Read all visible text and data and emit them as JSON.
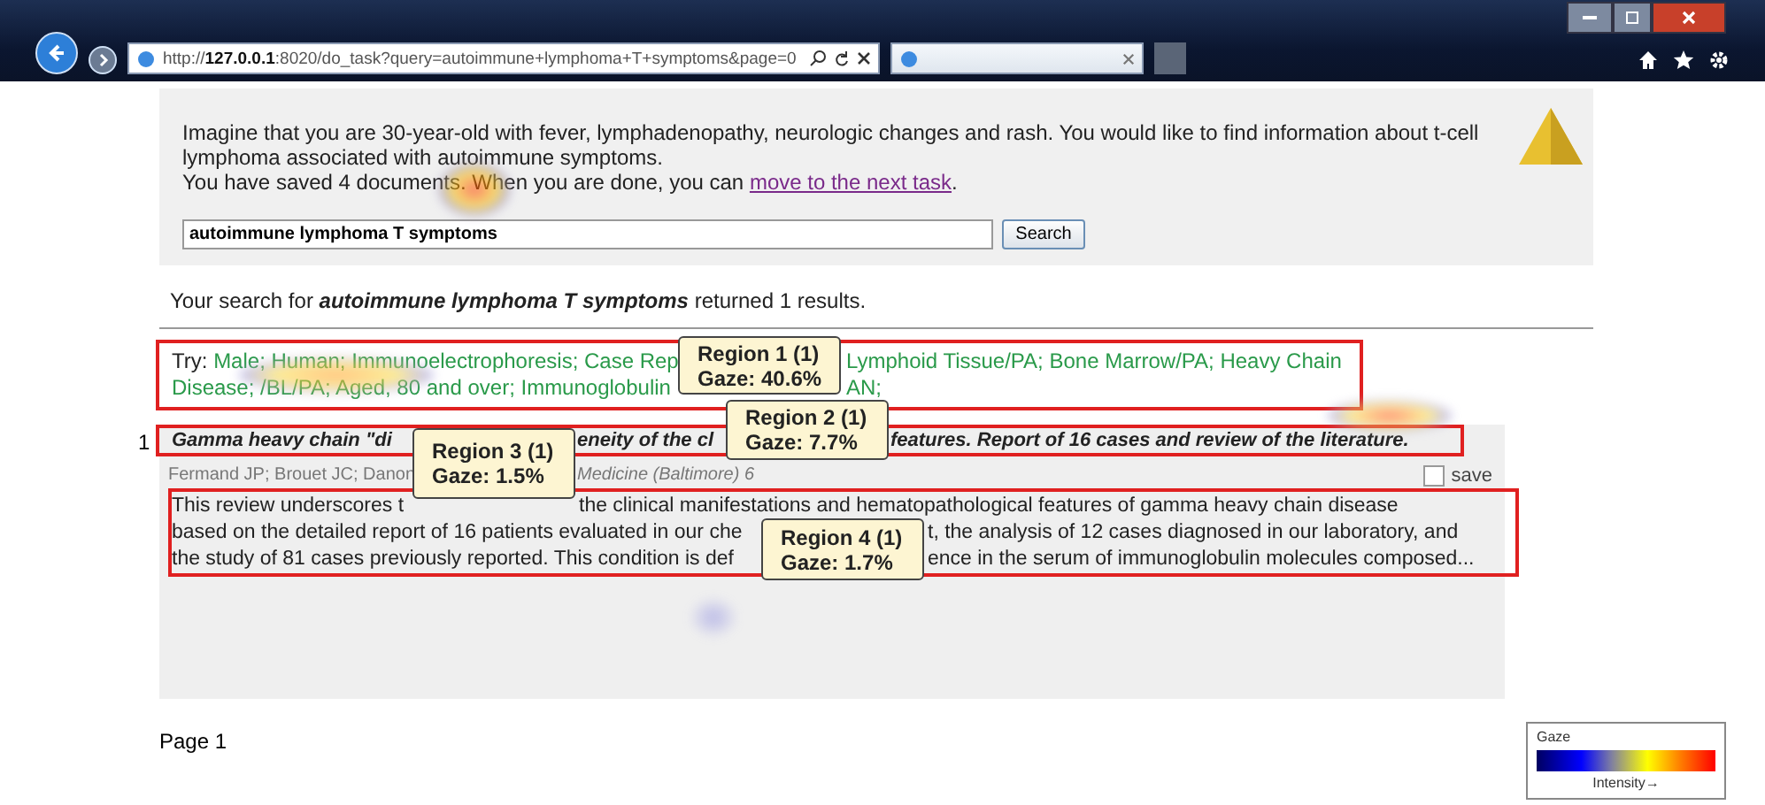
{
  "browser": {
    "address": "http://**127.0.0.1**:8020/do_task?query=autoimmune+lymphoma+T+symptoms&page=0"
  },
  "task": {
    "lines": [
      "Imagine that you are 30-year-old with fever, lymphadenopathy, neurologic changes and rash. You would like to find information about t-cell",
      "lymphoma associated with autoimmune symptoms."
    ],
    "saved_text": "You have saved 4 documents. When you are done, you can",
    "link": "move to the next task",
    "link_after": ".",
    "search": {
      "value": "autoimmune lymphoma T symptoms",
      "button": "Search"
    }
  },
  "summary": {
    "before": "Your search for",
    "query": "autoimmune lymphoma T symptoms",
    "after": "returned 1 results."
  },
  "try": {
    "label": "Try:",
    "lines": [
      [
        "Male; Human; Immunoelectrophoresis; Case Rep",
        "Lymphoid Tissue/PA; Bone Marrow/PA; Heavy Chain"
      ],
      [
        "Disease; /BL/PA; Aged, 80 and over; Immunoglobulin",
        "AN;"
      ]
    ]
  },
  "result": {
    "number": "1",
    "title": [
      "Gamma heavy chain \"di",
      "eneity of the cl",
      "features. Report of 16 cases and review of the literature."
    ],
    "authors": [
      "Fermand JP; Brouet JC; Danon",
      "Medicine (Baltimore) 6"
    ],
    "save": {
      "label": "save",
      "checked": false
    },
    "abstract": [
      [
        "This review underscores t",
        "the clinical manifestations and hematopathological features of gamma heavy chain disease"
      ],
      [
        "based on the detailed report of 16 patients evaluated in our che",
        "t, the analysis of 12 cases diagnosed in our laboratory, and"
      ],
      [
        "the study of 81 cases previously reported. This condition is def",
        "ence in the serum of immunoglobulin molecules composed..."
      ]
    ]
  },
  "regions": [
    {
      "name": "Region 1 (1)",
      "gaze": "Gaze: 40.6%"
    },
    {
      "name": "Region 2 (1)",
      "gaze": "Gaze: 7.7%"
    },
    {
      "name": "Region 3 (1)",
      "gaze": "Gaze: 1.5%"
    },
    {
      "name": "Region 4 (1)",
      "gaze": "Gaze: 1.7%"
    }
  ],
  "pager": "Page 1",
  "legend": {
    "title": "Gaze",
    "axis": "Intensity→"
  }
}
